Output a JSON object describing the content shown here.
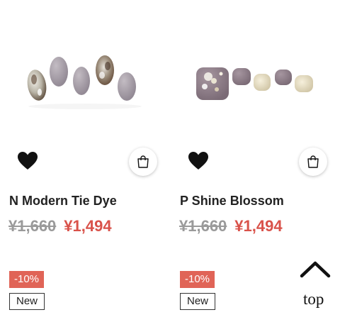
{
  "products": [
    {
      "name": "N Modern Tie Dye",
      "price_original": "¥1,660",
      "price_sale": "¥1,494",
      "discount": "-10%",
      "badge": "New",
      "image_icon": "nail-set-image"
    },
    {
      "name": "P Shine Blossom",
      "price_original": "¥1,660",
      "price_sale": "¥1,494",
      "discount": "-10%",
      "badge": "New",
      "image_icon": "nail-set-image"
    }
  ],
  "back_to_top": {
    "label": "top",
    "icon": "chevron-up-icon"
  },
  "colors": {
    "sale_price": "#d9524a",
    "discount_badge": "#e06457",
    "original_price": "#9a9a9a",
    "nail_mauve": "#8e7f88",
    "nail_lilac": "#a89fa7"
  }
}
